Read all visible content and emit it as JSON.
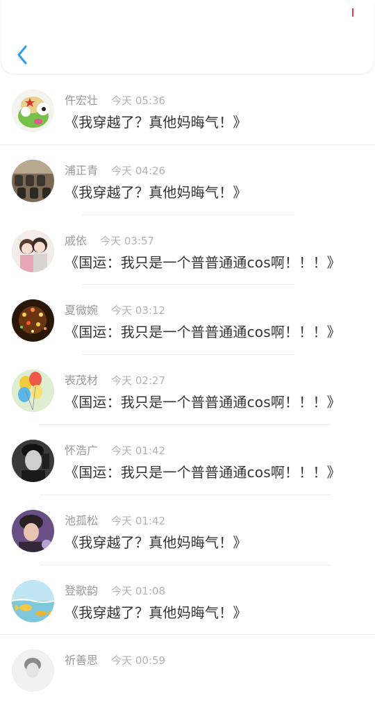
{
  "header": {
    "back_icon": "chevron-left-icon",
    "accent": "#2f9cf0"
  },
  "messages": [
    {
      "name": "仵宏壮",
      "time": "今天 05:36",
      "text": "《我穿越了？真他妈晦气！》",
      "avatar": "frog-cartoon-avatar"
    },
    {
      "name": "浦正青",
      "time": "今天 04:26",
      "text": "《我穿越了？真他妈晦气！》",
      "avatar": "theater-seats-avatar"
    },
    {
      "name": "戚依",
      "time": "今天 03:57",
      "text": "《国运：我只是一个普普通通cos啊！！！》",
      "avatar": "anime-couple-avatar"
    },
    {
      "name": "夏微婉",
      "time": "今天 03:12",
      "text": "《国运：我只是一个普普通通cos啊！！！》",
      "avatar": "lights-avatar"
    },
    {
      "name": "表茂材",
      "time": "今天 02:27",
      "text": "《国运：我只是一个普普通通cos啊！！！》",
      "avatar": "balloons-avatar"
    },
    {
      "name": "怀浩广",
      "time": "今天 01:42",
      "text": "《国运：我只是一个普普通通cos啊！！！》",
      "avatar": "man-bw-avatar"
    },
    {
      "name": "池孤松",
      "time": "今天 01:42",
      "text": "《我穿越了？真他妈晦气！》",
      "avatar": "boy-photo-avatar"
    },
    {
      "name": "登歌韵",
      "time": "今天 01:08",
      "text": "《我穿越了？真他妈晦气！》",
      "avatar": "fish-sea-avatar"
    },
    {
      "name": "祈善思",
      "time": "今天 00:59",
      "text": "",
      "avatar": "sketch-avatar"
    }
  ]
}
